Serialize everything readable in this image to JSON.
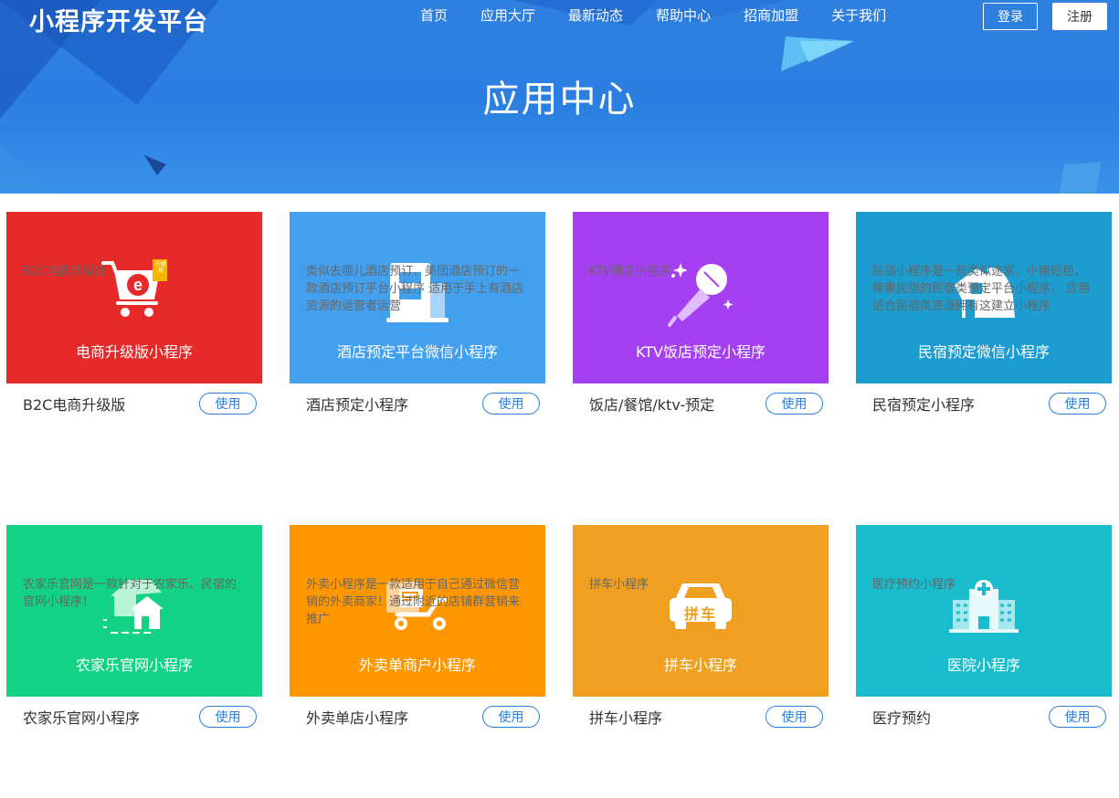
{
  "header": {
    "brand": "小程序开发平台",
    "nav": [
      "首页",
      "应用大厅",
      "最新动态",
      "帮助中心",
      "招商加盟",
      "关于我们"
    ],
    "login": "登录",
    "register": "注册",
    "title": "应用中心"
  },
  "colors": {
    "banner": "#2b7fe0",
    "accent": "#2f7fd6"
  },
  "apps": [
    {
      "banner_title": "电商升级版小程序",
      "name": "B2C电商升级版",
      "button": "使用",
      "desc": "B2C电商升级版",
      "color": "#e62a2a",
      "icon": "shopping-cart-icon",
      "badge": "升级版"
    },
    {
      "banner_title": "酒店预定平台微信小程序",
      "name": "酒店预定小程序",
      "button": "使用",
      "desc": "类似去哪儿酒店预订、美团酒店预订的一款酒店预订平台小程序 适用于手上有酒店资源的运营者运营",
      "color": "#42a0ee",
      "icon": "hotel-building-icon"
    },
    {
      "banner_title": "KTV饭店预定小程序",
      "name": "饭店/餐馆/ktv-预定",
      "button": "使用",
      "desc": "KTV预定小程序",
      "color": "#a43ff2",
      "icon": "microphone-icon"
    },
    {
      "banner_title": "民宿预定微信小程序",
      "name": "民宿预定小程序",
      "button": "使用",
      "desc": "民宿小程序是一款类似途家、小猪短租、榛果民宿的民宿类预定平台小程序， 应用适合民宿类资源拥有这建立小程序",
      "color": "#1c9ccf",
      "icon": "homestay-icon"
    },
    {
      "banner_title": "农家乐官网小程序",
      "name": "农家乐官网小程序",
      "button": "使用",
      "desc": "农家乐官网是一款针对于农家乐、民宿的官网小程序！",
      "color": "#12d283",
      "icon": "farmhouse-icon"
    },
    {
      "banner_title": "外卖单商户小程序",
      "name": "外卖单店小程序",
      "button": "使用",
      "desc": "外卖小程序是一款适用于自己通过微信营销的外卖商家！通过附近的店铺群营销来推广",
      "color": "#fe9600",
      "icon": "delivery-scooter-icon"
    },
    {
      "banner_title": "拼车小程序",
      "name": "拼车小程序",
      "button": "使用",
      "desc": "拼车小程序",
      "color": "#f0a020",
      "icon": "car-icon",
      "badge": "拼车"
    },
    {
      "banner_title": "医院小程序",
      "name": "医疗预约",
      "button": "使用",
      "desc": "医疗预约小程序",
      "color": "#18bccd",
      "icon": "hospital-icon"
    }
  ]
}
